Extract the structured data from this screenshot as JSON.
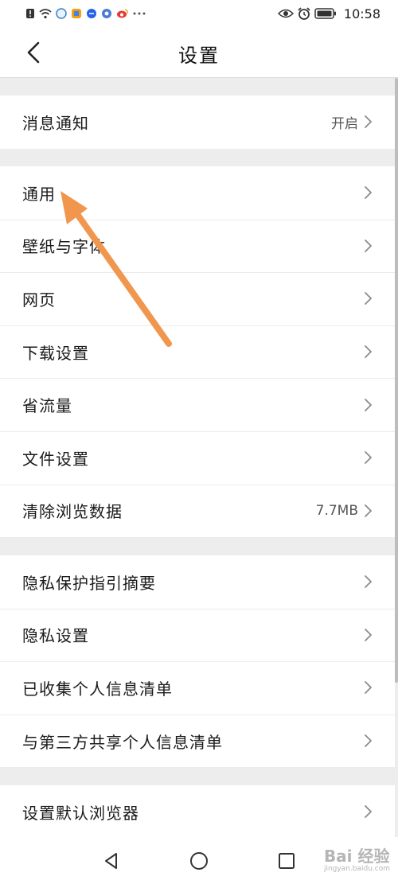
{
  "status_bar": {
    "time": "10:58",
    "left_icons": [
      "notification-icon",
      "wifi-icon",
      "app-icon-1",
      "app-icon-2",
      "app-icon-3",
      "app-icon-4",
      "weibo-icon",
      "more-icon"
    ],
    "right_icons": [
      "eye-icon",
      "alarm-icon",
      "battery-icon"
    ]
  },
  "header": {
    "title": "设置",
    "back_icon": "chevron-left-icon"
  },
  "groups": [
    {
      "items": [
        {
          "label": "消息通知",
          "value": "开启"
        }
      ]
    },
    {
      "items": [
        {
          "label": "通用",
          "value": ""
        },
        {
          "label": "壁纸与字体",
          "value": ""
        },
        {
          "label": "网页",
          "value": ""
        },
        {
          "label": "下载设置",
          "value": ""
        },
        {
          "label": "省流量",
          "value": ""
        },
        {
          "label": "文件设置",
          "value": ""
        },
        {
          "label": "清除浏览数据",
          "value": "7.7MB"
        }
      ]
    },
    {
      "items": [
        {
          "label": "隐私保护指引摘要",
          "value": ""
        },
        {
          "label": "隐私设置",
          "value": ""
        },
        {
          "label": "已收集个人信息清单",
          "value": ""
        },
        {
          "label": "与第三方共享个人信息清单",
          "value": ""
        }
      ]
    },
    {
      "items": [
        {
          "label": "设置默认浏览器",
          "value": ""
        }
      ]
    }
  ],
  "nav_bar": {
    "buttons": [
      "back-triangle-icon",
      "home-circle-icon",
      "recents-square-icon"
    ]
  },
  "watermark": {
    "text": "Bai 经验",
    "subtext": "jingyan.baidu.com"
  },
  "colors": {
    "background": "#ededed",
    "surface": "#ffffff",
    "arrow": "#f0964d",
    "chevron": "#8a8a8a"
  }
}
